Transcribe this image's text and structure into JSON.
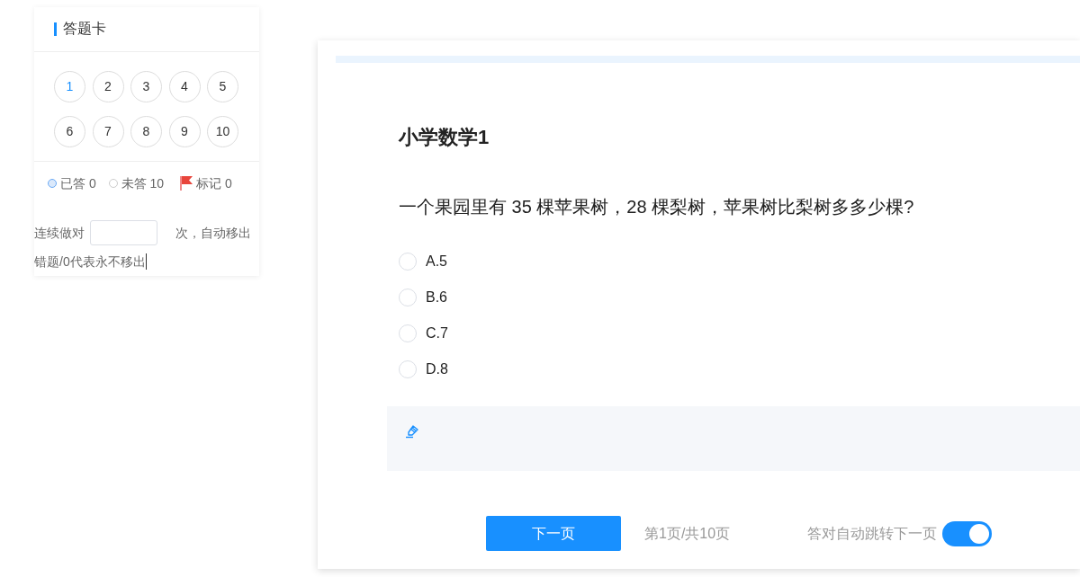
{
  "answer_card": {
    "title": "答题卡",
    "questions": [
      {
        "number": "1",
        "selected": true
      },
      {
        "number": "2",
        "selected": false
      },
      {
        "number": "3",
        "selected": false
      },
      {
        "number": "4",
        "selected": false
      },
      {
        "number": "5",
        "selected": false
      },
      {
        "number": "6",
        "selected": false
      },
      {
        "number": "7",
        "selected": false
      },
      {
        "number": "8",
        "selected": false
      },
      {
        "number": "9",
        "selected": false
      },
      {
        "number": "10",
        "selected": false
      }
    ],
    "legend": [
      {
        "kind": "answered",
        "label": "已答 0"
      },
      {
        "kind": "unanswered",
        "label": "未答 10"
      },
      {
        "kind": "marked",
        "label": "标记 0"
      }
    ],
    "auto_remove": {
      "prefix": "连续做对",
      "suffix": "次，自动移出",
      "continuation": "错题/0代表永不移出"
    }
  },
  "question_panel": {
    "title": "小学数学1",
    "question": "一个果园里有 35 棵苹果树，28 棵梨树，苹果树比梨树多多少棵?",
    "options": [
      {
        "label": "A.5",
        "selected": false
      },
      {
        "label": "B.6",
        "selected": false
      },
      {
        "label": "C.7",
        "selected": false
      },
      {
        "label": "D.8",
        "selected": false
      }
    ],
    "footer": {
      "next_button": "下一页",
      "page_info": "第1页/共10页",
      "auto_next": {
        "label": "答对自动跳转下一页",
        "on": true
      }
    }
  }
}
